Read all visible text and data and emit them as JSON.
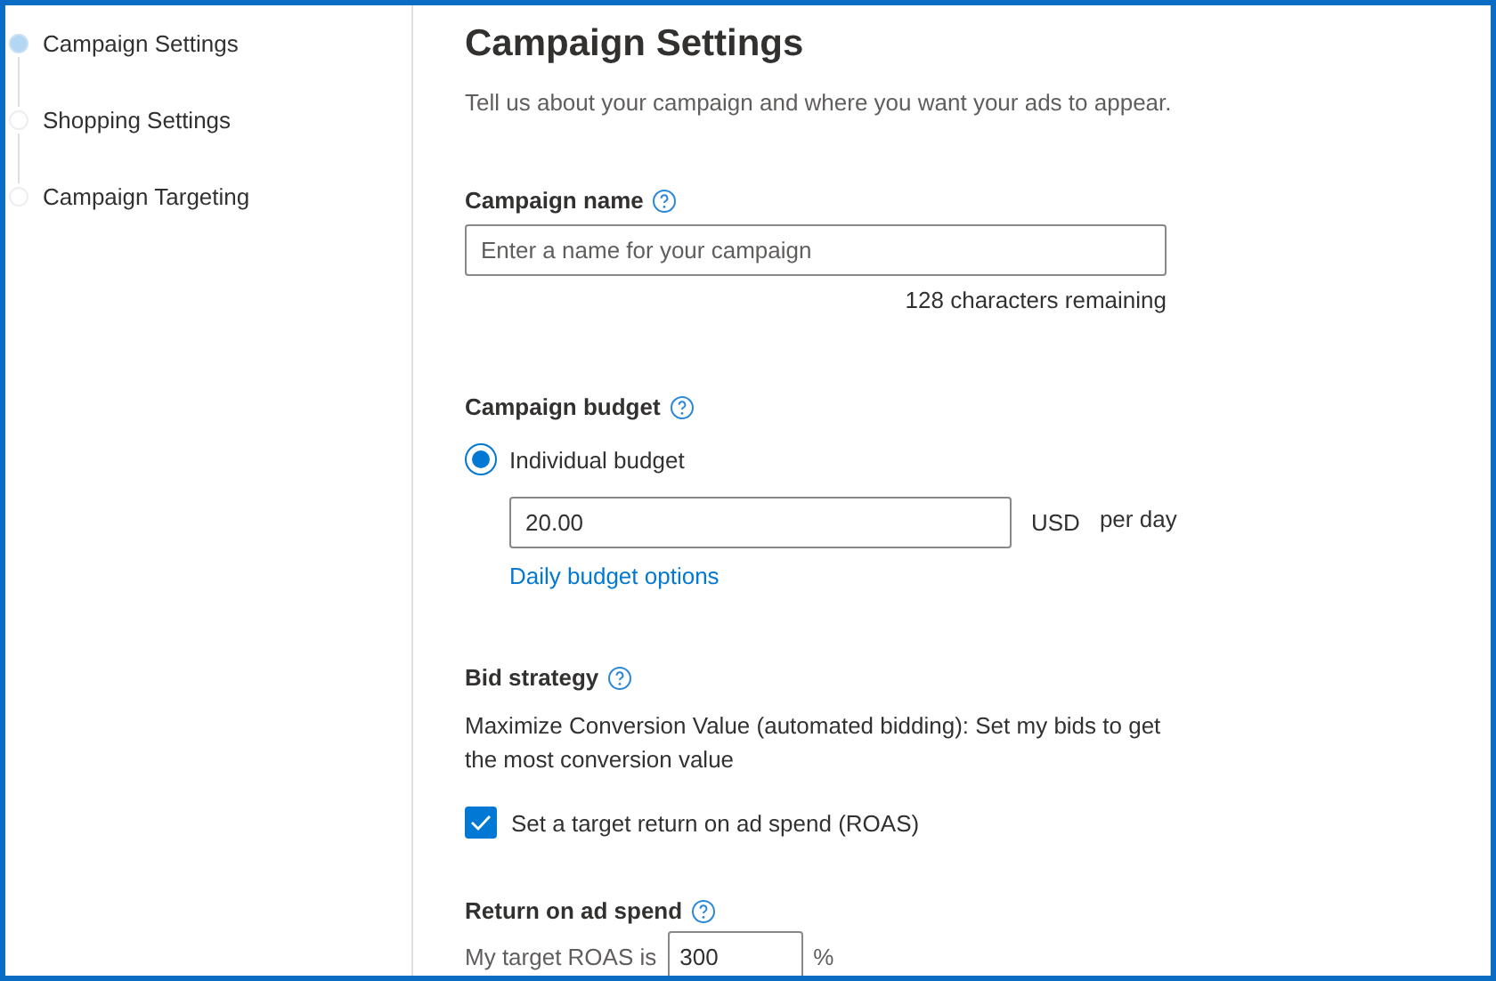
{
  "steps": [
    {
      "label": "Campaign Settings",
      "selected": true
    },
    {
      "label": "Shopping Settings",
      "selected": false
    },
    {
      "label": "Campaign Targeting",
      "selected": false
    }
  ],
  "title": "Campaign Settings",
  "subtitle": "Tell us about your campaign and where you want your ads to appear.",
  "campaign_name": {
    "label": "Campaign name",
    "placeholder": "Enter a name for your campaign",
    "remaining": "128 characters remaining"
  },
  "campaign_budget": {
    "label": "Campaign budget",
    "option": {
      "label": "Individual budget",
      "selected": true
    },
    "value": "20.00",
    "currency": "USD",
    "period": "per day",
    "link": "Daily budget options"
  },
  "bid_strategy": {
    "label": "Bid strategy",
    "description": "Maximize Conversion Value (automated bidding): Set my bids to get the most conversion value",
    "checkbox": {
      "label": "Set a target return on ad spend (ROAS)",
      "checked": true
    }
  },
  "roas": {
    "label": "Return on ad spend",
    "prefix": "My target ROAS is",
    "value": "300",
    "suffix": "%"
  }
}
